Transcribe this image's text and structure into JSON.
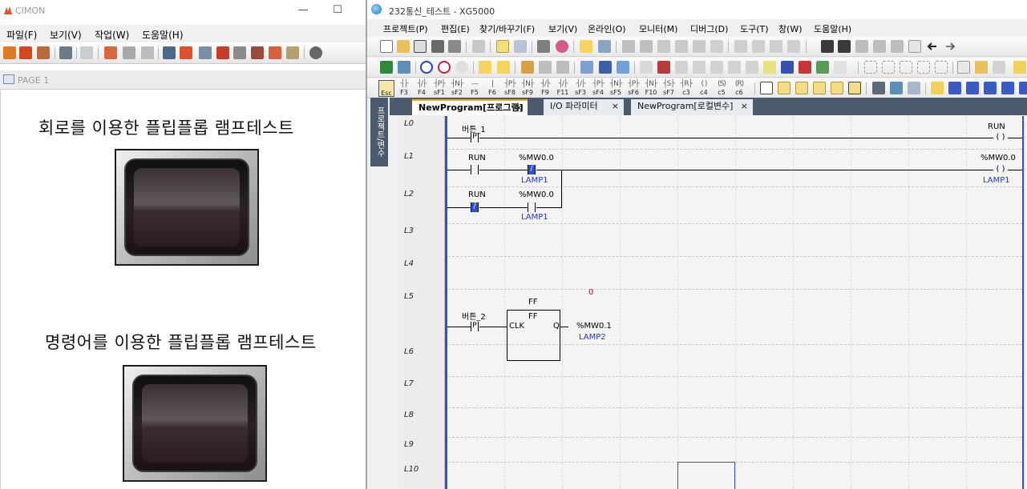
{
  "cimon": {
    "title": "CIMON",
    "window_controls": {
      "minimize": "—",
      "maximize": "☐"
    },
    "menu": [
      "파일(F)",
      "보기(V)",
      "작업(W)",
      "도움말(H)"
    ],
    "page_label": "PAGE 1",
    "heading1": "회로를 이용한 플립플롭 램프테스트",
    "heading2": "명령어를 이용한 플립플롭 램프테스트",
    "lamp1_state": "off",
    "lamp2_state": "off"
  },
  "xg": {
    "title": "232통신_테스트 - XG5000",
    "menu": [
      "프로젝트(P)",
      "편집(E)",
      "찾기/바꾸기(F)",
      "보기(V)",
      "온라인(O)",
      "모니터(M)",
      "디버그(D)",
      "도구(T)",
      "창(W)",
      "도움말(H)"
    ],
    "fkeys": [
      {
        "sym": "",
        "lbl": "Esc"
      },
      {
        "sym": "┤├",
        "lbl": "F3"
      },
      {
        "sym": "┤/├",
        "lbl": "F4"
      },
      {
        "sym": "┤P├",
        "lbl": "sF1"
      },
      {
        "sym": "┤N├",
        "lbl": "sF2"
      },
      {
        "sym": "—",
        "lbl": "F5"
      },
      {
        "sym": "|",
        "lbl": "F6"
      },
      {
        "sym": "┤P├",
        "lbl": "sF8"
      },
      {
        "sym": "┤N├",
        "lbl": "sF9"
      },
      {
        "sym": "┤/├",
        "lbl": "F9"
      },
      {
        "sym": "┤/├",
        "lbl": "F11"
      },
      {
        "sym": "┤/├",
        "lbl": "sF3"
      },
      {
        "sym": "┤P├",
        "lbl": "sF4"
      },
      {
        "sym": "┤N├",
        "lbl": "sF5"
      },
      {
        "sym": "┤P├",
        "lbl": "sF6"
      },
      {
        "sym": "┤N├",
        "lbl": "F10"
      },
      {
        "sym": "┤S├",
        "lbl": "sF7"
      },
      {
        "sym": "┤R├",
        "lbl": "c3"
      },
      {
        "sym": "( )",
        "lbl": "c4"
      },
      {
        "sym": "(S)",
        "lbl": "c5"
      },
      {
        "sym": "(R)",
        "lbl": "c6"
      }
    ],
    "side_tab": "프로젝트/변수",
    "tabs": [
      {
        "label": "NewProgram[프로그램]",
        "active": true
      },
      {
        "label": "I/O 파라미터",
        "active": false
      },
      {
        "label": "NewProgram[로컬변수]",
        "active": false
      }
    ],
    "tab_close": "×",
    "rows": [
      "L0",
      "L1",
      "L2",
      "L3",
      "L4",
      "L5",
      "L6",
      "L7",
      "L8",
      "L9",
      "L10"
    ],
    "ladder": {
      "r0_contact": "버튼_1",
      "r0_contact_type": "P",
      "r0_coil": "RUN",
      "r1_contact1": "RUN",
      "r1_contact2": "%MW0.0",
      "r1_contact2_comment": "LAMP1",
      "r1_coil": "%MW0.0",
      "r1_coil_comment": "LAMP1",
      "r2_contact1": "RUN",
      "r2_contact2": "%MW0.0",
      "r2_contact2_comment": "LAMP1",
      "fb_instance": "FF",
      "fb_type": "FF",
      "fb_value": "0",
      "fb_in": "CLK",
      "fb_out": "Q",
      "fb_contact": "버튼_2",
      "fb_contact_type": "P",
      "fb_out_var": "%MW0.1",
      "fb_out_comment": "LAMP2",
      "coil_symbol": "( )"
    }
  }
}
